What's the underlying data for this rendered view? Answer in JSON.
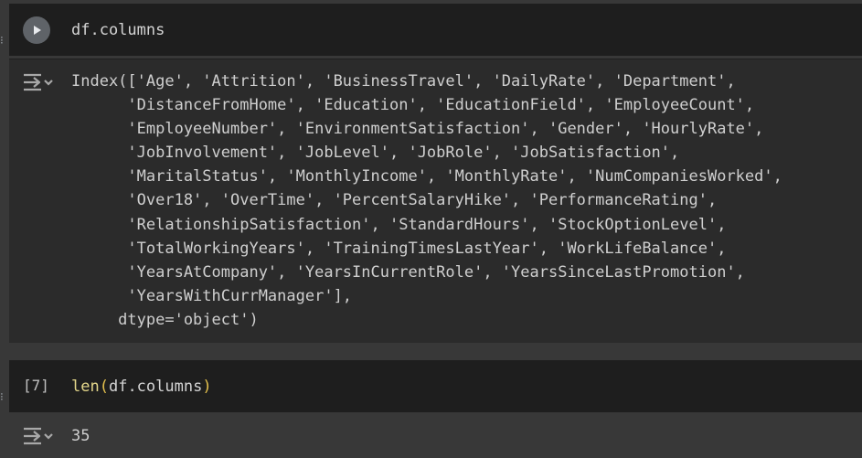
{
  "cells": [
    {
      "code": "df.columns",
      "output": "Index(['Age', 'Attrition', 'BusinessTravel', 'DailyRate', 'Department',\n      'DistanceFromHome', 'Education', 'EducationField', 'EmployeeCount',\n      'EmployeeNumber', 'EnvironmentSatisfaction', 'Gender', 'HourlyRate',\n      'JobInvolvement', 'JobLevel', 'JobRole', 'JobSatisfaction',\n      'MaritalStatus', 'MonthlyIncome', 'MonthlyRate', 'NumCompaniesWorked',\n      'Over18', 'OverTime', 'PercentSalaryHike', 'PerformanceRating',\n      'RelationshipSatisfaction', 'StandardHours', 'StockOptionLevel',\n      'TotalWorkingYears', 'TrainingTimesLastYear', 'WorkLifeBalance',\n      'YearsAtCompany', 'YearsInCurrentRole', 'YearsSinceLastPromotion',\n      'YearsWithCurrManager'],\n     dtype='object')"
    },
    {
      "execution_count": "[7]",
      "code_fn": "len",
      "code_open": "(",
      "code_arg": "df.columns",
      "code_close": ")",
      "output": "35"
    }
  ],
  "icons": {
    "run": "play-circle-icon",
    "output": "output-toggle-icon"
  },
  "colors": {
    "background": "#383838",
    "cell_background": "#1e1e1e",
    "output_background": "#2b2b2b",
    "text": "#cfcfcf",
    "function": "#e3d68a",
    "paren": "#e3c04d"
  }
}
